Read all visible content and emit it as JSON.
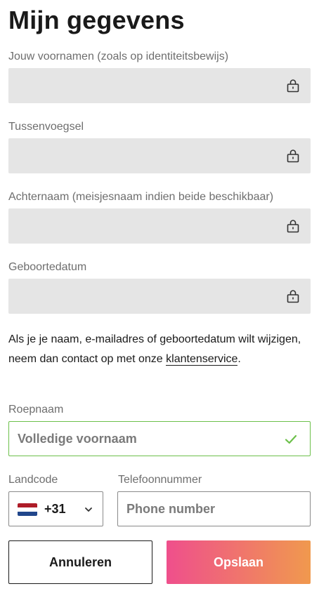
{
  "page": {
    "title": "Mijn gegevens"
  },
  "locked_fields": [
    {
      "label": "Jouw voornamen (zoals op identiteitsbewijs)",
      "value": "",
      "icon": "lock-icon"
    },
    {
      "label": "Tussenvoegsel",
      "value": "",
      "icon": "lock-icon"
    },
    {
      "label": "Achternaam (meisjesnaam indien beide beschikbaar)",
      "value": "",
      "icon": "lock-icon"
    },
    {
      "label": "Geboortedatum",
      "value": "",
      "icon": "lock-icon"
    }
  ],
  "info": {
    "text": "Als je je naam, e-mailadres of geboortedatum wilt wijzigen, neem dan contact op met onze ",
    "link_text": "klantenservice",
    "suffix": "."
  },
  "nickname": {
    "label": "Roepnaam",
    "value": "",
    "placeholder": "Volledige voornaam",
    "status_icon": "check-icon",
    "status_color": "#6cc04a"
  },
  "phone": {
    "country_label": "Landcode",
    "country_flag": "netherlands-flag",
    "dial_code": "+31",
    "number_label": "Telefoonnummer",
    "number_value": "",
    "number_placeholder": "Phone number"
  },
  "actions": {
    "cancel_label": "Annuleren",
    "save_label": "Opslaan",
    "save_gradient": [
      "#ef4f8c",
      "#f0994e"
    ]
  }
}
